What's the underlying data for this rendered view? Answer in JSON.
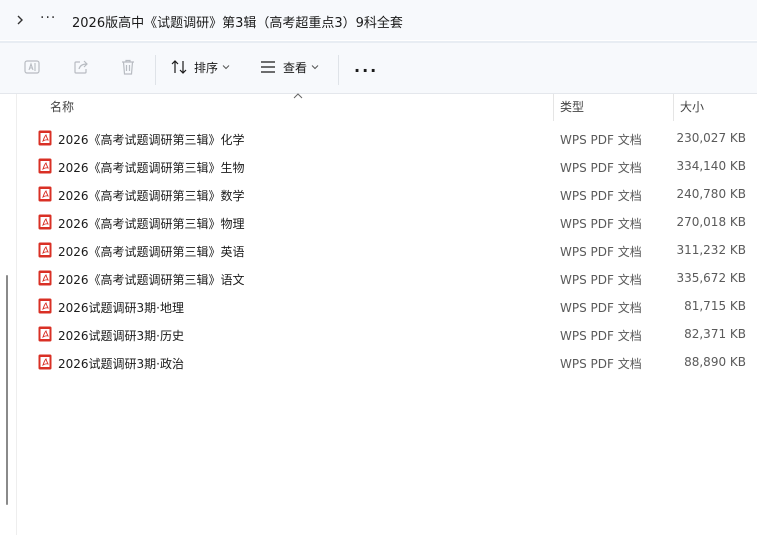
{
  "breadcrumb": {
    "more_label": "···",
    "title": "2026版高中《试题调研》第3辑（高考超重点3）9科全套"
  },
  "toolbar": {
    "rename_icon": "rename-icon",
    "share_icon": "share-icon",
    "delete_icon": "delete-icon",
    "sort_label": "排序",
    "view_label": "查看",
    "more_label": "···"
  },
  "columns": {
    "name": "名称",
    "type": "类型",
    "size": "大小"
  },
  "files": [
    {
      "name": "2026《高考试题调研第三辑》化学",
      "type": "WPS PDF 文档",
      "size": "230,027 KB"
    },
    {
      "name": "2026《高考试题调研第三辑》生物",
      "type": "WPS PDF 文档",
      "size": "334,140 KB"
    },
    {
      "name": "2026《高考试题调研第三辑》数学",
      "type": "WPS PDF 文档",
      "size": "240,780 KB"
    },
    {
      "name": "2026《高考试题调研第三辑》物理",
      "type": "WPS PDF 文档",
      "size": "270,018 KB"
    },
    {
      "name": "2026《高考试题调研第三辑》英语",
      "type": "WPS PDF 文档",
      "size": "311,232 KB"
    },
    {
      "name": "2026《高考试题调研第三辑》语文",
      "type": "WPS PDF 文档",
      "size": "335,672 KB"
    },
    {
      "name": "2026试题调研3期·地理",
      "type": "WPS PDF 文档",
      "size": "81,715 KB"
    },
    {
      "name": "2026试题调研3期·历史",
      "type": "WPS PDF 文档",
      "size": "82,371 KB"
    },
    {
      "name": "2026试题调研3期·政治",
      "type": "WPS PDF 文档",
      "size": "88,890 KB"
    }
  ],
  "colors": {
    "pdf_icon": "#d93025",
    "toolbar_bg": "#f7f9fc"
  }
}
